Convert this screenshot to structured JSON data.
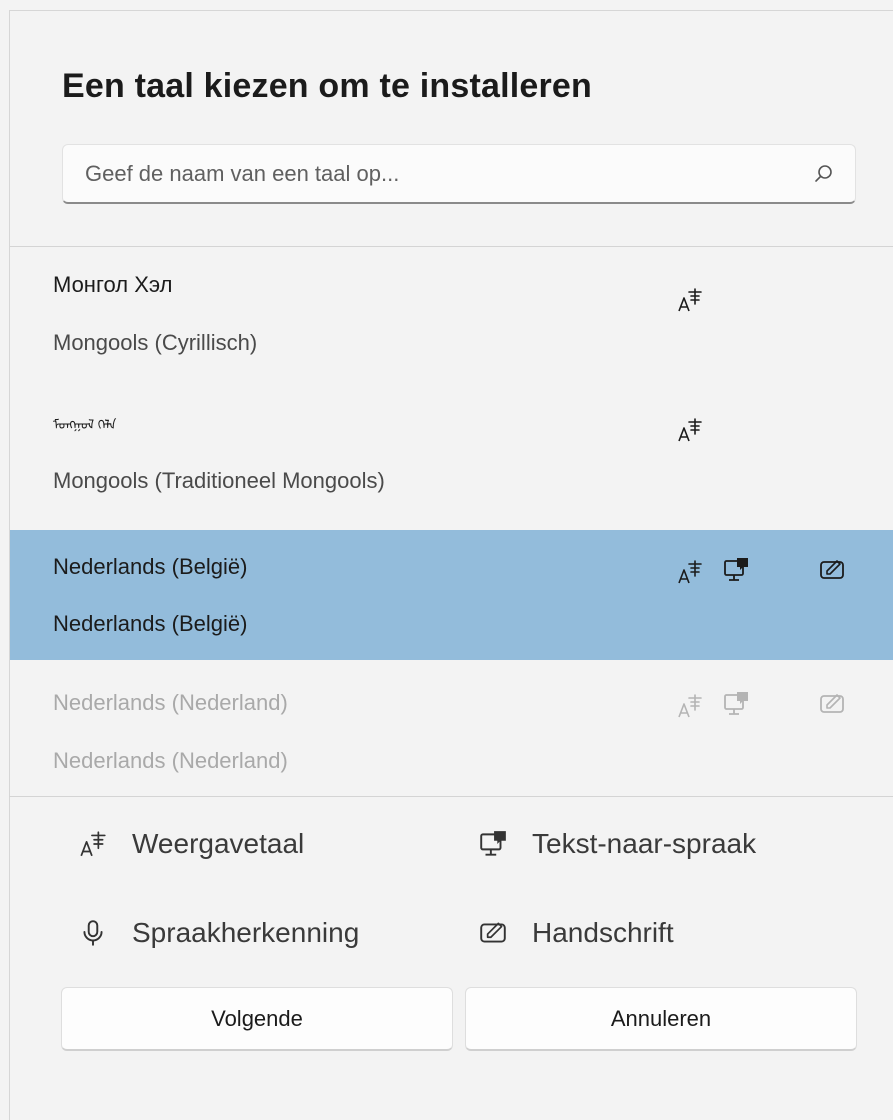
{
  "dialog": {
    "title": "Een taal kiezen om te installeren",
    "search": {
      "placeholder": "Geef de naam van een taal op...",
      "value": "",
      "icon": "search-icon"
    },
    "languages": [
      {
        "native": "Монгол Хэл",
        "name": "Mongools (Cyrillisch)",
        "state": "normal",
        "features": [
          "display-language-icon"
        ]
      },
      {
        "native": "ᠮᠣᠩᠭᠣᠯ ᠬᠡᠯᠡ",
        "name": "Mongools (Traditioneel Mongools)",
        "state": "normal",
        "features": [
          "display-language-icon"
        ]
      },
      {
        "native": "Nederlands (België)",
        "name": "Nederlands (België)",
        "state": "selected",
        "features": [
          "display-language-icon",
          "text-to-speech-icon",
          "handwriting-icon"
        ]
      },
      {
        "native": "Nederlands (Nederland)",
        "name": "Nederlands (Nederland)",
        "state": "disabled",
        "features": [
          "display-language-icon",
          "text-to-speech-icon",
          "handwriting-icon"
        ]
      }
    ],
    "legend": {
      "display_language": "Weergavetaal",
      "text_to_speech": "Tekst-naar-spraak",
      "speech_recognition": "Spraakherkenning",
      "handwriting": "Handschrift"
    },
    "buttons": {
      "next": "Volgende",
      "cancel": "Annuleren"
    },
    "colors": {
      "selected_bg": "#93bcdb",
      "disabled_text": "#a9a9a9",
      "background": "#f3f3f3"
    }
  }
}
